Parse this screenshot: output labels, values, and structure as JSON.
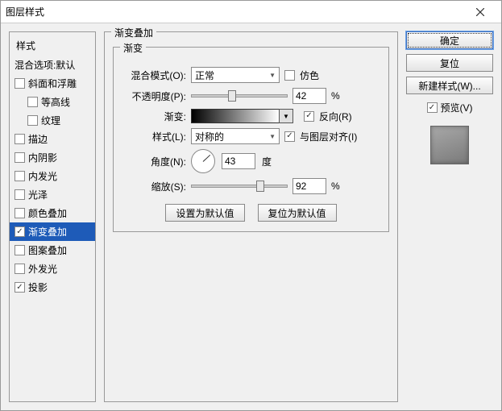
{
  "window": {
    "title": "图层样式"
  },
  "left": {
    "header": "样式",
    "blending": "混合选项:默认",
    "items": [
      {
        "label": "斜面和浮雕",
        "checked": false,
        "sub": false
      },
      {
        "label": "等高线",
        "checked": false,
        "sub": true
      },
      {
        "label": "纹理",
        "checked": false,
        "sub": true
      },
      {
        "label": "描边",
        "checked": false,
        "sub": false
      },
      {
        "label": "内阴影",
        "checked": false,
        "sub": false
      },
      {
        "label": "内发光",
        "checked": false,
        "sub": false
      },
      {
        "label": "光泽",
        "checked": false,
        "sub": false
      },
      {
        "label": "颜色叠加",
        "checked": false,
        "sub": false
      },
      {
        "label": "渐变叠加",
        "checked": true,
        "sub": false,
        "selected": true
      },
      {
        "label": "图案叠加",
        "checked": false,
        "sub": false
      },
      {
        "label": "外发光",
        "checked": false,
        "sub": false
      },
      {
        "label": "投影",
        "checked": true,
        "sub": false
      }
    ]
  },
  "mid": {
    "groupTitle": "渐变叠加",
    "subTitle": "渐变",
    "blendModeLabel": "混合模式(O):",
    "blendModeValue": "正常",
    "ditherLabel": "仿色",
    "ditherChecked": false,
    "opacityLabel": "不透明度(P):",
    "opacityValue": "42",
    "opacityPct": 42,
    "percent": "%",
    "gradientLabel": "渐变:",
    "reverseLabel": "反向(R)",
    "reverseChecked": true,
    "styleLabel": "样式(L):",
    "styleValue": "对称的",
    "alignLabel": "与图层对齐(I)",
    "alignChecked": true,
    "angleLabel": "角度(N):",
    "angleValue": "43",
    "degree": "度",
    "scaleLabel": "缩放(S):",
    "scaleValue": "92",
    "scalePct": 92,
    "btnDefault": "设置为默认值",
    "btnReset": "复位为默认值"
  },
  "right": {
    "ok": "确定",
    "cancel": "复位",
    "newStyle": "新建样式(W)...",
    "previewLabel": "预览(V)",
    "previewChecked": true
  }
}
